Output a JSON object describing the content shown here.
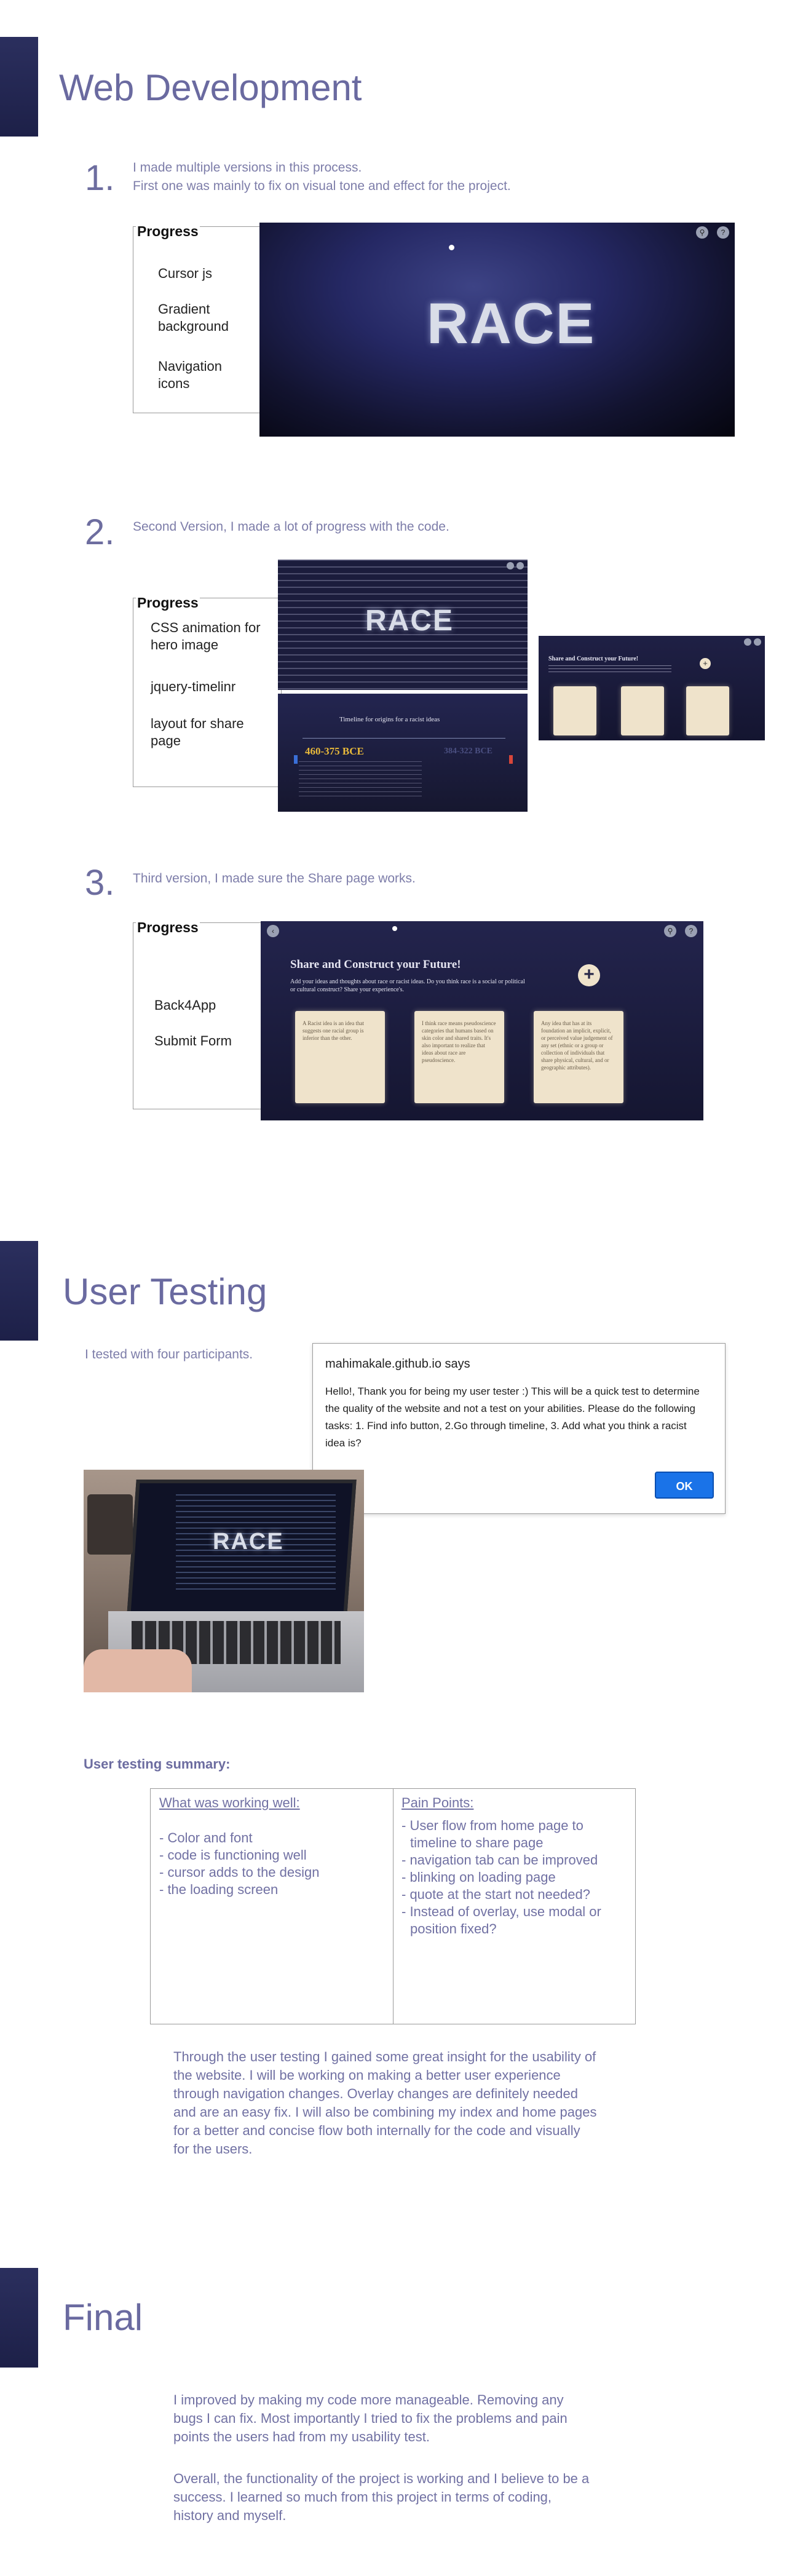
{
  "web_dev": {
    "title": "Web Development",
    "step1": {
      "number": "1.",
      "line1": "I made multiple versions in this process.",
      "line2": "First one was mainly to fix on visual tone and effect for the project.",
      "progress_title": "Progress",
      "items": [
        "Cursor js",
        "Gradient background",
        "Navigation icons"
      ],
      "hero_word": "RACE"
    },
    "step2": {
      "number": "2.",
      "text": "Second Version, I made a lot of progress with the code.",
      "progress_title": "Progress",
      "items": [
        "CSS animation for hero image",
        "jquery-timelinr",
        "layout for share page"
      ],
      "hero_word": "RACE",
      "timeline_title": "Timeline for origins for a racist ideas",
      "timeline_date_left": "460-375 BCE",
      "timeline_date_right": "384-322 BCE",
      "share_title": "Share and Construct your Future!"
    },
    "step3": {
      "number": "3.",
      "text": "Third version, I made sure the Share page works.",
      "progress_title": "Progress",
      "items": [
        "Back4App",
        "Submit Form"
      ],
      "share_title": "Share and Construct your Future!",
      "share_sub": "Add your ideas and thoughts about race or racist ideas. Do you think race is a social or political or cultural construct? Share your experience's.",
      "plus": "+",
      "cards": [
        "A Racist idea is an idea that suggests one racial group is inferior than the other.",
        "I think race means pseudoscience categories that humans based on skin color and shared traits. It's also important to realize that ideas about race are pseudoscience.",
        "Any idea that has at its foundation an implicit, explicit, or perceived value judgement of any set (ethnic or a group or collection of individuals that share physical, cultural, and or geographic attributes)."
      ]
    }
  },
  "user_testing": {
    "title": "User Testing",
    "intro": "I tested with four participants.",
    "dialog": {
      "origin": "mahimakale.github.io says",
      "message": "Hello!, Thank you for being my user tester :) This will be a quick test to determine the quality of the website and not a test on your abilities. Please do the following tasks: 1. Find info button, 2.Go through timeline, 3. Add what you think a racist idea is?",
      "ok_label": "OK"
    },
    "photo_word": "RACE",
    "summary_heading": "User testing summary:",
    "well": {
      "heading": "What was working well:",
      "items": [
        "- Color and font",
        "- code is functioning well",
        "- cursor adds to the design",
        "- the loading screen"
      ]
    },
    "pain": {
      "heading": "Pain Points:",
      "items": [
        "- User flow from home page to timeline to share page",
        "- navigation tab can be improved",
        "- blinking on loading page",
        "- quote at the start not needed?",
        "- Instead of overlay, use modal or position fixed?"
      ]
    },
    "conclusion": "Through the user testing I gained some great insight for the usability of the website. I will be working on making a better user experience through navigation changes. Overlay changes are definitely needed and are an easy fix. I will also be combining my index and home pages for a better and concise flow both internally for the code and visually for the users."
  },
  "final": {
    "title": "Final",
    "para1": "I improved by making my code more manageable. Removing any bugs I can fix. Most importantly I tried to fix the problems and pain points the users had from my usability test.",
    "para2": "Overall, the functionality of the project is working and I believe to be a success. I learned so much from this project in terms of coding, history and myself."
  }
}
